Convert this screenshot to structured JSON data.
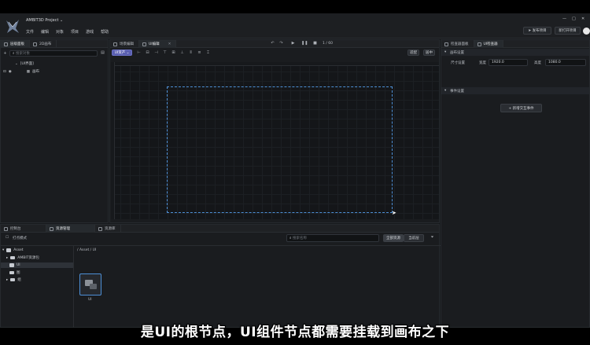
{
  "app": {
    "project_name": "AMBIT3D Project",
    "menu": [
      "文件",
      "编辑",
      "对象",
      "项目",
      "游戏",
      "帮助"
    ],
    "publish_label": "发布项目",
    "open_label": "新打开项目"
  },
  "hierarchy": {
    "tabs": [
      {
        "label": "层级面板"
      },
      {
        "label": "2D画布"
      }
    ],
    "search_placeholder": "搜索对象",
    "root": "[UI界面]",
    "child": "画布"
  },
  "scene": {
    "tabs": [
      {
        "label": "场景编辑"
      },
      {
        "label": "UI编辑"
      }
    ],
    "mode_label": "UI资产",
    "frame_label": "1 / 60",
    "right_buttons": [
      "适配",
      "居中"
    ]
  },
  "inspector": {
    "tabs": [
      {
        "label": "检查器面板"
      },
      {
        "label": "UI检查器"
      }
    ],
    "section1": "画布设置",
    "size_label": "尺寸设置",
    "width_label": "宽度",
    "width_value": "1920.0",
    "height_label": "高度",
    "height_value": "1080.0",
    "section2": "事件设置",
    "add_event_label": "+ 新增交互事件"
  },
  "bottom": {
    "tabs": [
      {
        "label": "控制台"
      },
      {
        "label": "资源管理"
      },
      {
        "label": "资源库"
      }
    ],
    "open_mode_label": "打点模式",
    "search_placeholder": "搜索名称",
    "filter_buttons": [
      "全部资源",
      "当前层"
    ],
    "tree": [
      "Asset",
      "AMBIT资源包",
      "UI",
      "图",
      "组"
    ],
    "path": "/ Asset  / UI",
    "asset_label": "UI"
  },
  "subtitle": "是UI的根节点，UI组件节点都需要挂载到画布之下"
}
